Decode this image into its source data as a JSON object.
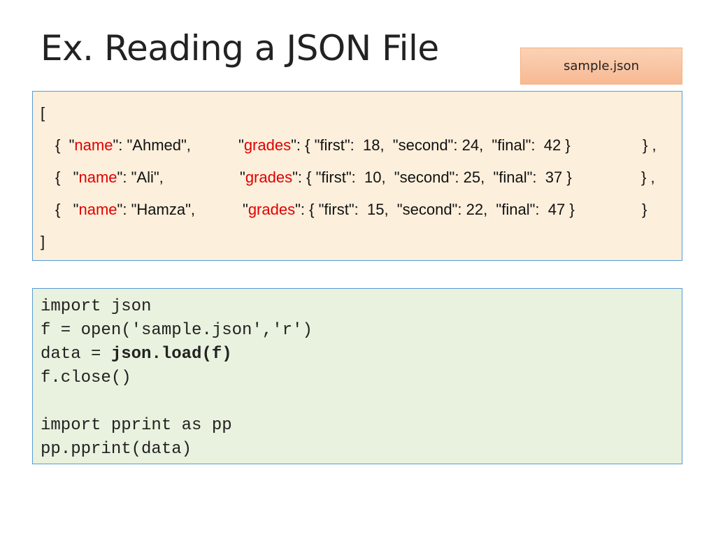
{
  "slide": {
    "title": "Ex. Reading a JSON File",
    "file_label": "sample.json"
  },
  "json_sample": {
    "open_bracket": "[",
    "close_bracket": "]",
    "records": [
      {
        "name": "Ahmed",
        "first": "18",
        "second": "24",
        "final": "42",
        "separator": ","
      },
      {
        "name": "Ali",
        "first": "10",
        "second": "25",
        "final": "37",
        "separator": ","
      },
      {
        "name": "Hamza",
        "first": "15",
        "second": "22",
        "final": "47",
        "separator": ""
      }
    ]
  },
  "code": {
    "lines": [
      "import json",
      "f = open('sample.json','r')",
      "data = ",
      "f.close()",
      "",
      "import pprint as pp",
      "pp.pprint(data)"
    ],
    "bold_call": "json.load(f)"
  },
  "colors": {
    "key_color": "#e00000",
    "json_bg": "#fcefdc",
    "code_bg": "#e9f2de",
    "box_border": "#5b9bd5",
    "badge_bg": "#f8c3a0"
  }
}
